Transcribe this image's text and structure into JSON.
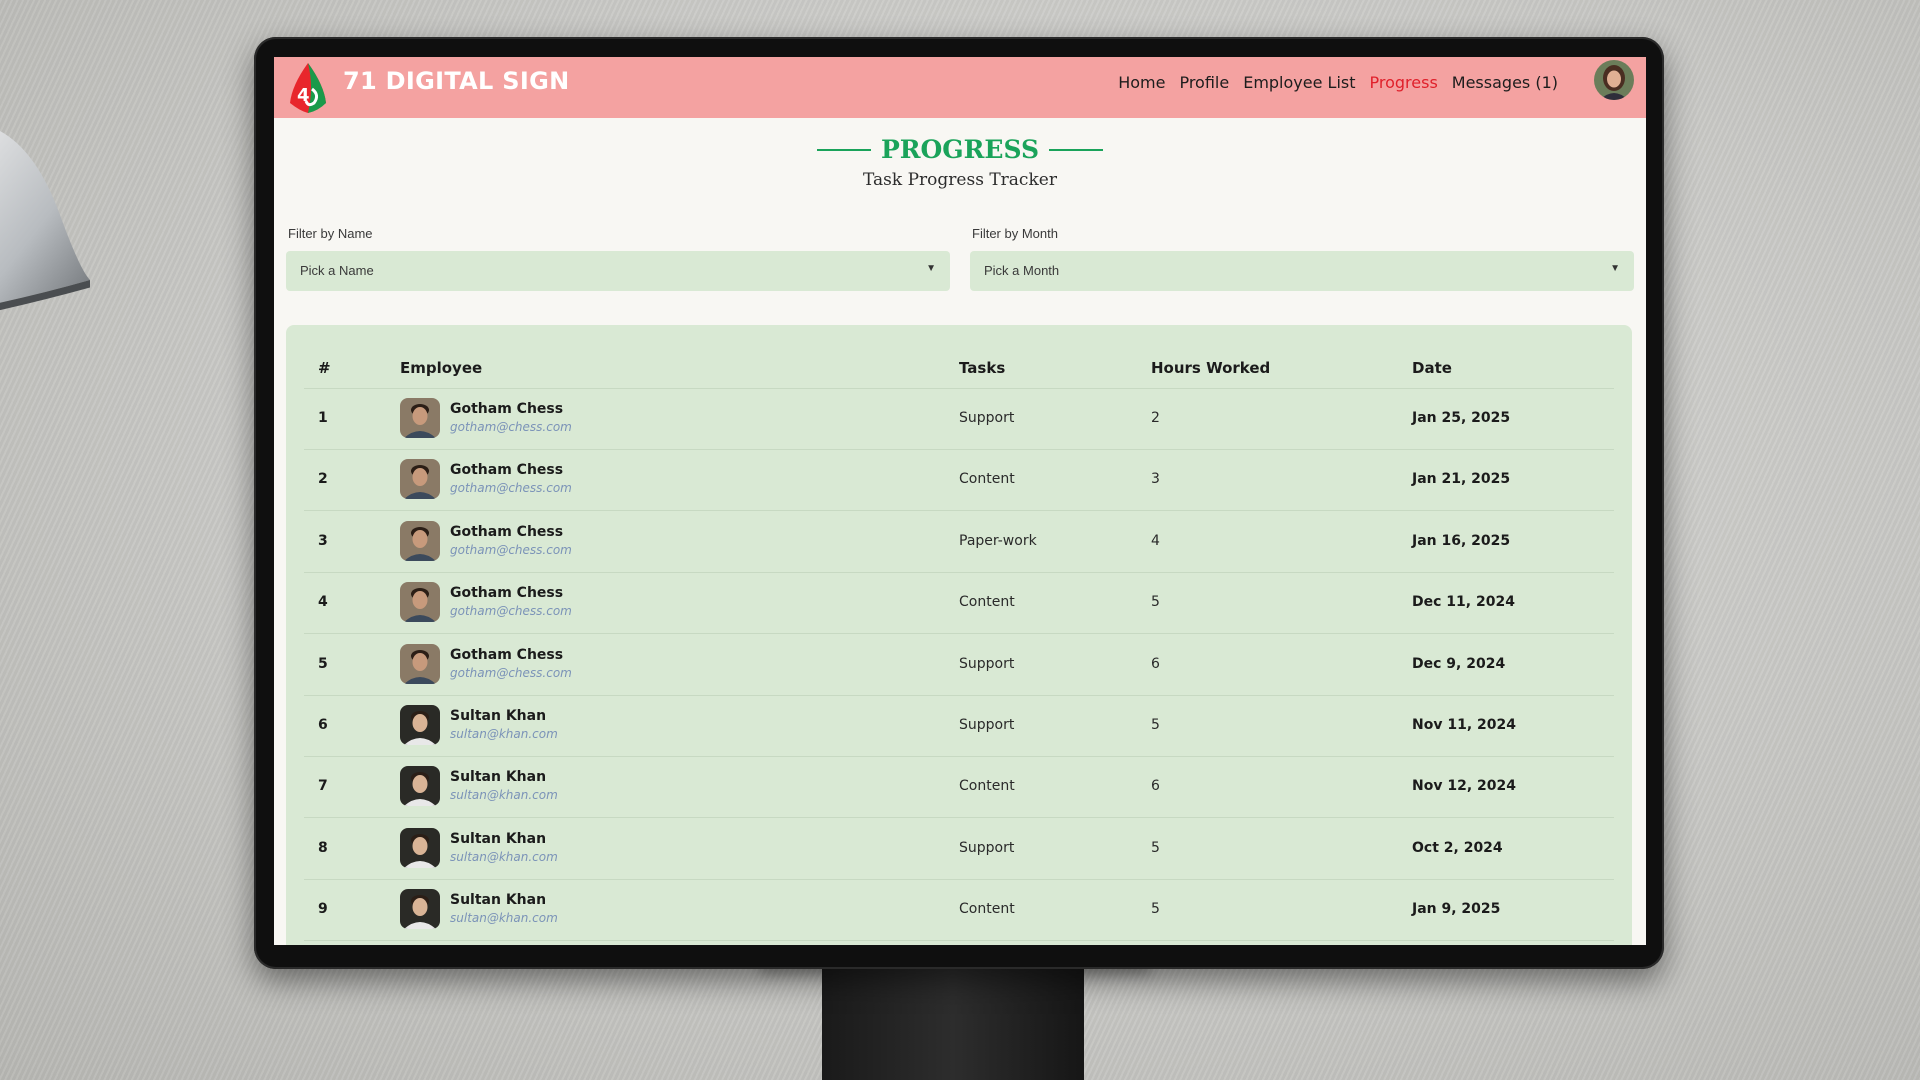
{
  "brand": {
    "name": "71 DIGITAL SIGN"
  },
  "nav": {
    "items": [
      {
        "label": "Home"
      },
      {
        "label": "Profile"
      },
      {
        "label": "Employee List"
      },
      {
        "label": "Progress"
      },
      {
        "label": "Messages (1)"
      }
    ],
    "active_index": 3
  },
  "page": {
    "title": "PROGRESS",
    "subtitle": "Task Progress Tracker"
  },
  "filters": {
    "name": {
      "label": "Filter by Name",
      "placeholder": "Pick a Name"
    },
    "month": {
      "label": "Filter by Month",
      "placeholder": "Pick a Month"
    }
  },
  "table": {
    "headers": [
      "#",
      "Employee",
      "Tasks",
      "Hours Worked",
      "Date"
    ],
    "rows": [
      {
        "num": "1",
        "name": "Gotham Chess",
        "email": "gotham@chess.com",
        "task": "Support",
        "hours": "2",
        "date": "Jan 25, 2025"
      },
      {
        "num": "2",
        "name": "Gotham Chess",
        "email": "gotham@chess.com",
        "task": "Content",
        "hours": "3",
        "date": "Jan 21, 2025"
      },
      {
        "num": "3",
        "name": "Gotham Chess",
        "email": "gotham@chess.com",
        "task": "Paper-work",
        "hours": "4",
        "date": "Jan 16, 2025"
      },
      {
        "num": "4",
        "name": "Gotham Chess",
        "email": "gotham@chess.com",
        "task": "Content",
        "hours": "5",
        "date": "Dec 11, 2024"
      },
      {
        "num": "5",
        "name": "Gotham Chess",
        "email": "gotham@chess.com",
        "task": "Support",
        "hours": "6",
        "date": "Dec 9, 2024"
      },
      {
        "num": "6",
        "name": "Sultan Khan",
        "email": "sultan@khan.com",
        "task": "Support",
        "hours": "5",
        "date": "Nov 11, 2024"
      },
      {
        "num": "7",
        "name": "Sultan Khan",
        "email": "sultan@khan.com",
        "task": "Content",
        "hours": "6",
        "date": "Nov 12, 2024"
      },
      {
        "num": "8",
        "name": "Sultan Khan",
        "email": "sultan@khan.com",
        "task": "Support",
        "hours": "5",
        "date": "Oct 2, 2024"
      },
      {
        "num": "9",
        "name": "Sultan Khan",
        "email": "sultan@khan.com",
        "task": "Content",
        "hours": "5",
        "date": "Jan 9, 2025"
      }
    ]
  },
  "colors": {
    "navbar": "#f4a2a1",
    "accent_green": "#1aa35a",
    "active_nav": "#e0202b",
    "card": "#d9e9d4",
    "email": "#7b93b8"
  },
  "icons": {
    "logo": "71-digital-sign-logo",
    "dropdown": "caret-down-icon",
    "user_avatar": "user-avatar",
    "employee_avatar": "employee-avatar"
  }
}
